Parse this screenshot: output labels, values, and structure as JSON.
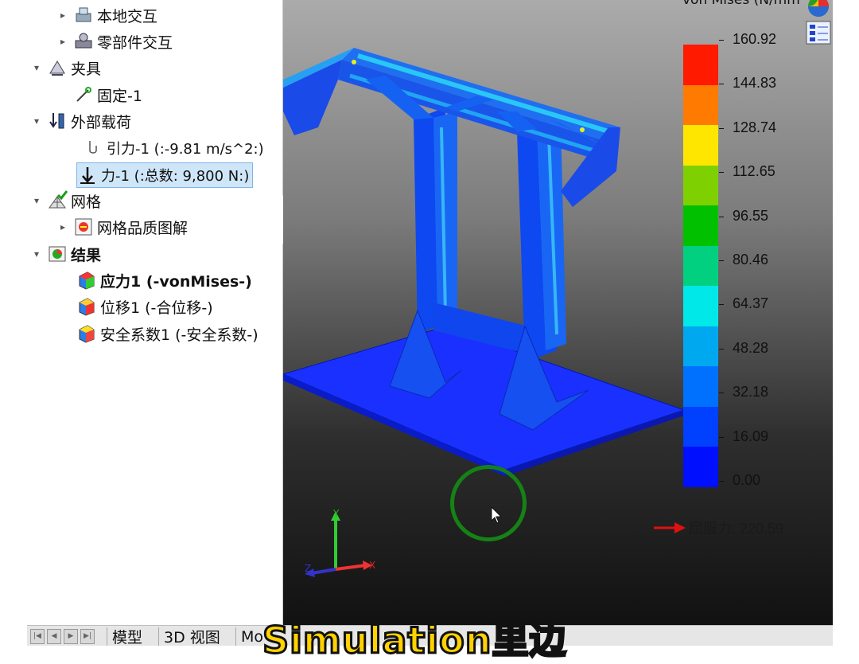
{
  "tree": {
    "items": [
      {
        "label": "本地交互",
        "arrow": "▸",
        "icon": "interaction-icon"
      },
      {
        "label": "零部件交互",
        "arrow": "▸",
        "icon": "component-interaction-icon"
      },
      {
        "label": "夹具",
        "arrow": "▾",
        "icon": "fixture-icon"
      },
      {
        "label": "固定-1",
        "arrow": "",
        "icon": "fixed-geometry-icon"
      },
      {
        "label": "外部载荷",
        "arrow": "▾",
        "icon": "external-load-icon"
      },
      {
        "label": "引力-1 (:-9.81 m/s^2:)",
        "arrow": "",
        "icon": "gravity-icon"
      },
      {
        "label": "力-1 (:总数: 9,800 N:)",
        "arrow": "",
        "icon": "force-arrow-icon"
      },
      {
        "label": "网格",
        "arrow": "▾",
        "icon": "mesh-icon"
      },
      {
        "label": "网格品质图解",
        "arrow": "▸",
        "icon": "mesh-quality-icon"
      },
      {
        "label": "结果",
        "arrow": "▾",
        "icon": "results-folder-icon"
      },
      {
        "label": "应力1 (-vonMises-)",
        "arrow": "",
        "icon": "stress-plot-icon"
      },
      {
        "label": "位移1 (-合位移-)",
        "arrow": "",
        "icon": "displacement-plot-icon"
      },
      {
        "label": "安全系数1 (-安全系数-)",
        "arrow": "",
        "icon": "factor-of-safety-icon"
      }
    ]
  },
  "legend": {
    "title": "von Mises (N/mm",
    "ticks": [
      "160.92",
      "144.83",
      "128.74",
      "112.65",
      "96.55",
      "80.46",
      "64.37",
      "48.28",
      "32.18",
      "16.09",
      "0.00"
    ],
    "colors": [
      "#ff1a00",
      "#ff7a00",
      "#ffe600",
      "#7fd000",
      "#00c000",
      "#00d080",
      "#00e8e8",
      "#00a8f0",
      "#0070ff",
      "#0040ff",
      "#0010ff"
    ],
    "yield_label": "屈服力: 220.59",
    "yield_arrow_color": "#e01010"
  },
  "tabs": [
    "模型",
    "3D 视图",
    "Mo"
  ],
  "triad": {
    "x": "X",
    "y": "Y",
    "z": "Z"
  },
  "caption": "Simulation里边"
}
